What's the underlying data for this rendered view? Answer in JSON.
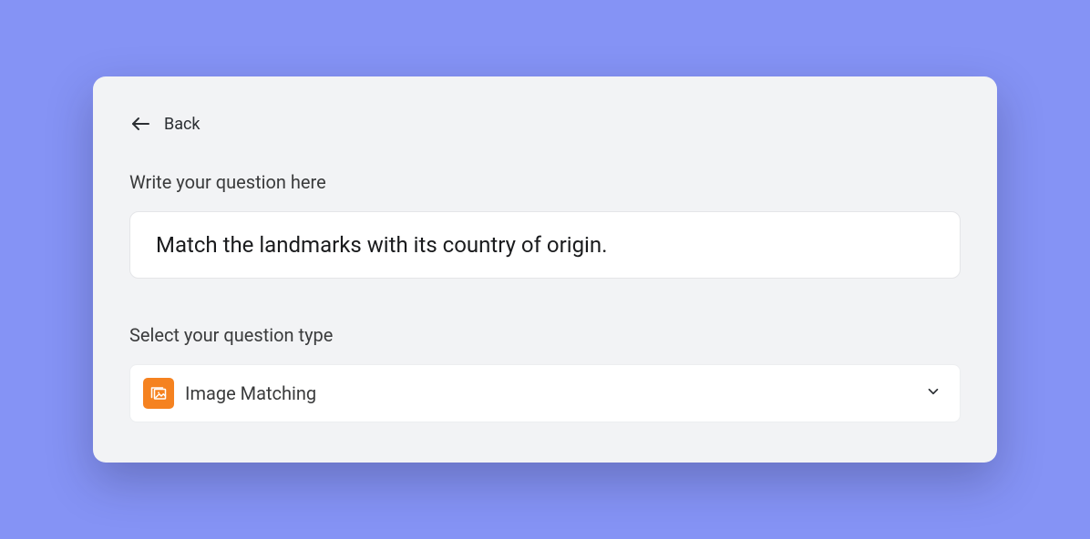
{
  "back": {
    "label": "Back"
  },
  "question": {
    "label": "Write your question here",
    "value": "Match the landmarks with its country of origin."
  },
  "type": {
    "label": "Select your question type",
    "selected": "Image Matching"
  }
}
